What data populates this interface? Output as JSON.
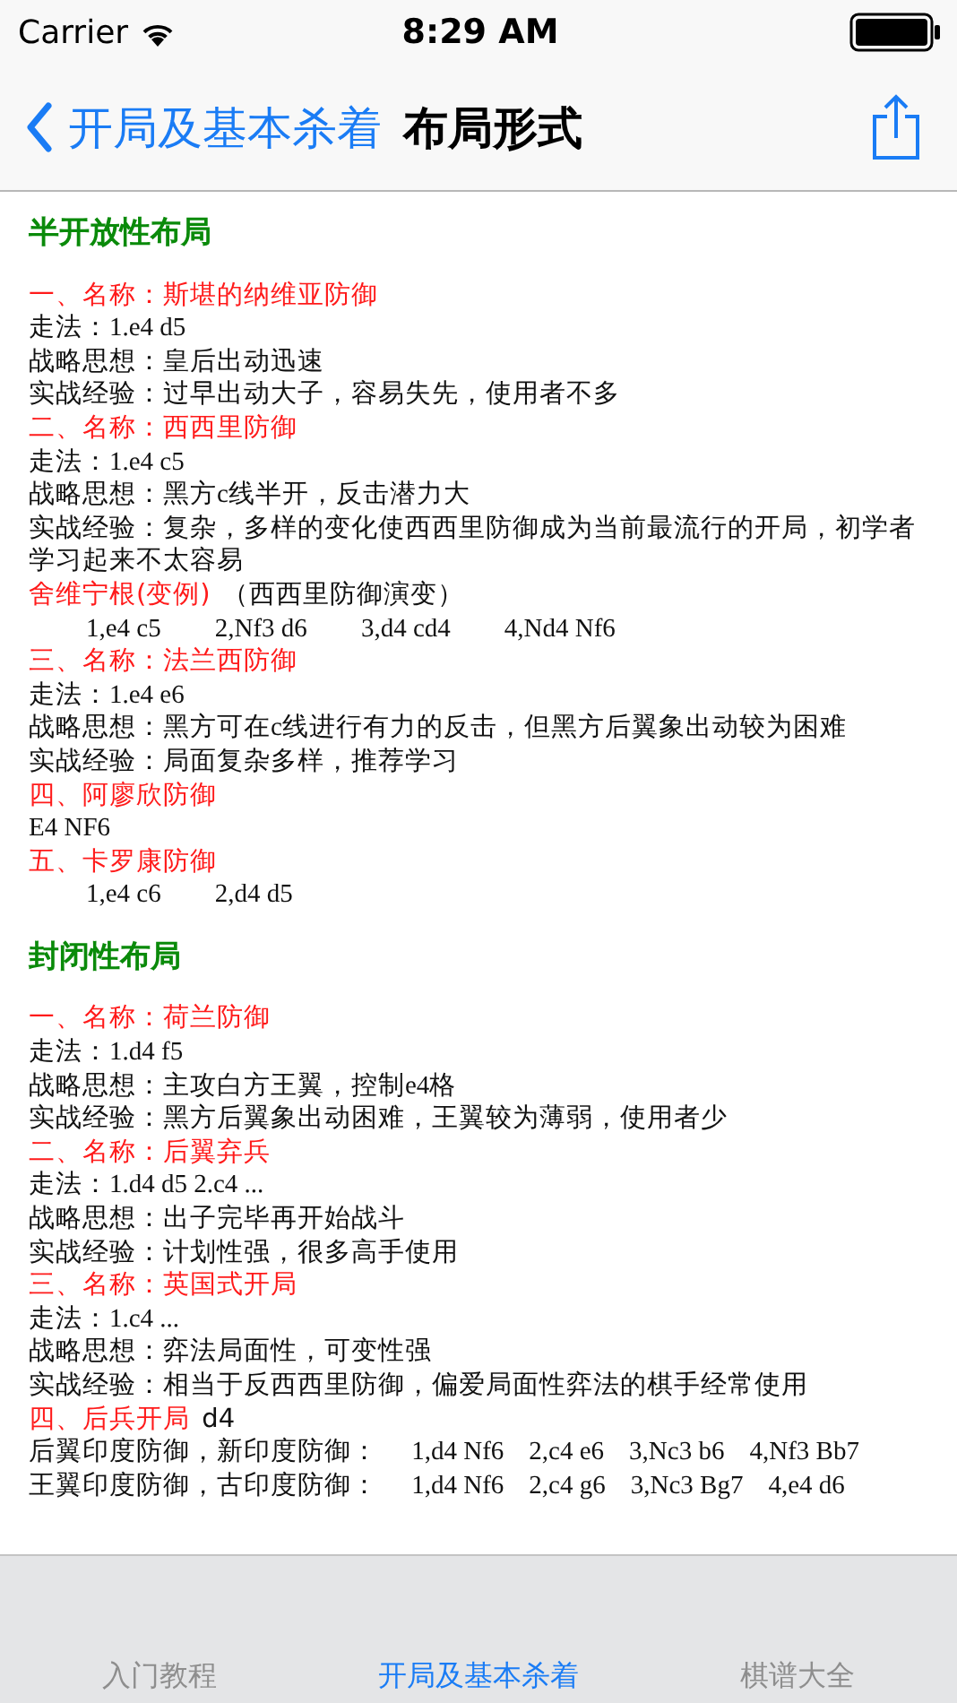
{
  "status_bar": {
    "carrier": "Carrier",
    "time": "8:29 AM"
  },
  "nav_bar": {
    "back_label": "开局及基本杀着",
    "title": "布局形式"
  },
  "sections": [
    {
      "title": "半开放性布局",
      "lines": [
        {
          "kind": "heading",
          "text": "一、名称：斯堪的纳维亚防御"
        },
        {
          "kind": "field",
          "label": "走法：",
          "value": "1.e4 d5"
        },
        {
          "kind": "field",
          "label": "战略思想：",
          "value": "皇后出动迅速"
        },
        {
          "kind": "field",
          "label": "实战经验：",
          "value": "过早出动大子，容易失先，使用者不多"
        },
        {
          "kind": "heading",
          "text": "二、名称：西西里防御"
        },
        {
          "kind": "field",
          "label": "走法：",
          "value": "1.e4 c5"
        },
        {
          "kind": "field",
          "label": "战略思想：",
          "value": "黑方c线半开，反击潜力大"
        },
        {
          "kind": "field",
          "label": "实战经验：",
          "value": "复杂，多样的变化使西西里防御成为当前最流行的开局，初学者学习起来不太容易"
        },
        {
          "kind": "heading",
          "text": "舍维宁根(变例)",
          "note": "（西西里防御演变）"
        },
        {
          "kind": "moves",
          "moves": [
            "1,e4 c5",
            "2,Nf3 d6",
            "3,d4 cd4",
            "4,Nd4 Nf6"
          ]
        },
        {
          "kind": "heading",
          "text": "三、名称：法兰西防御"
        },
        {
          "kind": "field",
          "label": "走法：",
          "value": "1.e4 e6"
        },
        {
          "kind": "field",
          "label": "战略思想：",
          "value": "黑方可在c线进行有力的反击，但黑方后翼象出动较为困难"
        },
        {
          "kind": "field",
          "label": "实战经验：",
          "value": "局面复杂多样，推荐学习"
        },
        {
          "kind": "heading",
          "text": "四、阿廖欣防御"
        },
        {
          "kind": "plain",
          "text": "E4 NF6"
        },
        {
          "kind": "heading",
          "text": "五、卡罗康防御"
        },
        {
          "kind": "moves",
          "moves": [
            "1,e4 c6",
            "2,d4 d5"
          ]
        }
      ]
    },
    {
      "title": "封闭性布局",
      "lines": [
        {
          "kind": "heading",
          "text": "一、名称：荷兰防御"
        },
        {
          "kind": "field",
          "label": "走法：",
          "value": "1.d4 f5"
        },
        {
          "kind": "field",
          "label": "战略思想：",
          "value": "主攻白方王翼，控制e4格"
        },
        {
          "kind": "field",
          "label": "实战经验：",
          "value": "黑方后翼象出动困难，王翼较为薄弱，使用者少"
        },
        {
          "kind": "heading",
          "text": "二、名称：后翼弃兵"
        },
        {
          "kind": "field",
          "label": "走法：",
          "value": "1.d4 d5 2.c4 ..."
        },
        {
          "kind": "field",
          "label": "战略思想：",
          "value": "出子完毕再开始战斗"
        },
        {
          "kind": "field",
          "label": "实战经验：",
          "value": "计划性强，很多高手使用"
        },
        {
          "kind": "heading",
          "text": "三、名称：英国式开局"
        },
        {
          "kind": "field",
          "label": "走法：",
          "value": "1.c4 ..."
        },
        {
          "kind": "field",
          "label": "战略思想：",
          "value": "弈法局面性，可变性强"
        },
        {
          "kind": "field",
          "label": "实战经验：",
          "value": "相当于反西西里防御，偏爱局面性弈法的棋手经常使用"
        },
        {
          "kind": "heading",
          "text": "四、后兵开局",
          "note": "d4"
        },
        {
          "kind": "field",
          "label": "后翼印度防御，新印度防御：",
          "moves": [
            "1,d4 Nf6",
            "2,c4 e6",
            "3,Nc3 b6",
            "4,Nf3 Bb7"
          ]
        },
        {
          "kind": "field",
          "label": "王翼印度防御，古印度防御：",
          "moves": [
            "1,d4 Nf6",
            "2,c4 g6",
            "3,Nc3 Bg7",
            "4,e4 d6"
          ]
        }
      ]
    }
  ],
  "tabs": [
    {
      "label": "入门教程",
      "selected": false
    },
    {
      "label": "开局及基本杀着",
      "selected": true
    },
    {
      "label": "棋谱大全",
      "selected": false
    }
  ]
}
